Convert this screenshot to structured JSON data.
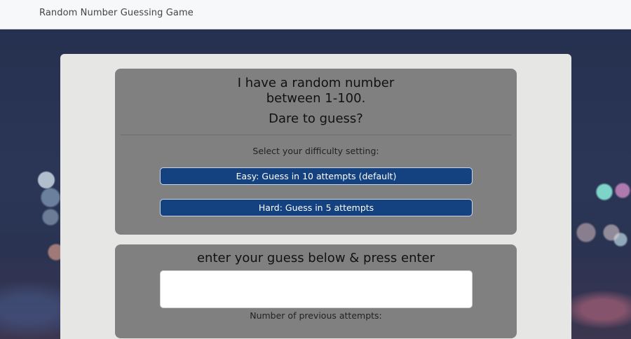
{
  "navbar": {
    "brand": "Random Number Guessing Game"
  },
  "intro": {
    "line1": "I have a random number",
    "line2": "between 1-100.",
    "line3": "Dare to guess?"
  },
  "difficulty": {
    "label": "Select your difficulty setting:",
    "easy_label": "Easy: Guess in 10 attempts (default)",
    "hard_label": "Hard: Guess in 5 attempts"
  },
  "guess": {
    "headline": "enter your guess below & press enter",
    "input_value": "",
    "attempts_label": "Number of previous attempts:"
  },
  "colors": {
    "button_bg": "#14417f",
    "panel_bg": "#808080",
    "card_bg": "#e6e7e4"
  }
}
